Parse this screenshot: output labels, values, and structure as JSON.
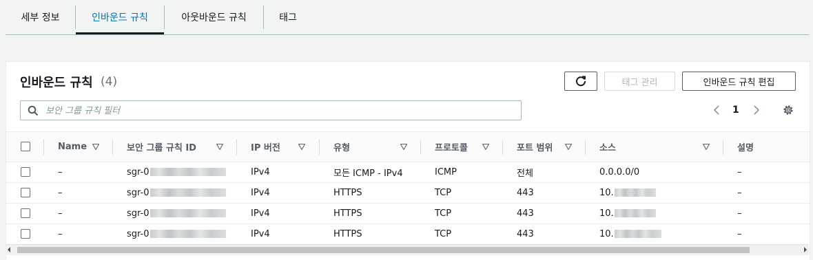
{
  "tabs": [
    {
      "label": "세부 정보",
      "active": false
    },
    {
      "label": "인바운드 규칙",
      "active": true
    },
    {
      "label": "아웃바운드 규칙",
      "active": false
    },
    {
      "label": "태그",
      "active": false
    }
  ],
  "panel": {
    "title": "인바운드 규칙",
    "count": "(4)",
    "refresh_icon": "refresh-icon",
    "manage_tags_label": "태그 관리",
    "edit_inbound_label": "인바운드 규칙 편집",
    "search_placeholder": "보안 그룹 규칙 필터",
    "page_number": "1"
  },
  "table": {
    "columns": [
      "Name",
      "보안 그룹 규칙 ID",
      "IP 버전",
      "유형",
      "프로토콜",
      "포트 범위",
      "소스",
      "설명"
    ],
    "rows": [
      {
        "name": "–",
        "rule_id": "sgr-0",
        "ip_version": "IPv4",
        "type": "모든 ICMP - IPv4",
        "protocol": "ICMP",
        "port_range": "전체",
        "source": "0.0.0.0/0",
        "description": "–"
      },
      {
        "name": "–",
        "rule_id": "sgr-0",
        "ip_version": "IPv4",
        "type": "HTTPS",
        "protocol": "TCP",
        "port_range": "443",
        "source": "10.",
        "description": "–"
      },
      {
        "name": "–",
        "rule_id": "sgr-0",
        "ip_version": "IPv4",
        "type": "HTTPS",
        "protocol": "TCP",
        "port_range": "443",
        "source": "10.",
        "description": "–"
      },
      {
        "name": "–",
        "rule_id": "sgr-0",
        "ip_version": "IPv4",
        "type": "HTTPS",
        "protocol": "TCP",
        "port_range": "443",
        "source": "10.",
        "description": "–"
      }
    ]
  },
  "colors": {
    "accent": "#0073bb",
    "text": "#16191f",
    "muted": "#687078",
    "border": "#aab7b8"
  }
}
